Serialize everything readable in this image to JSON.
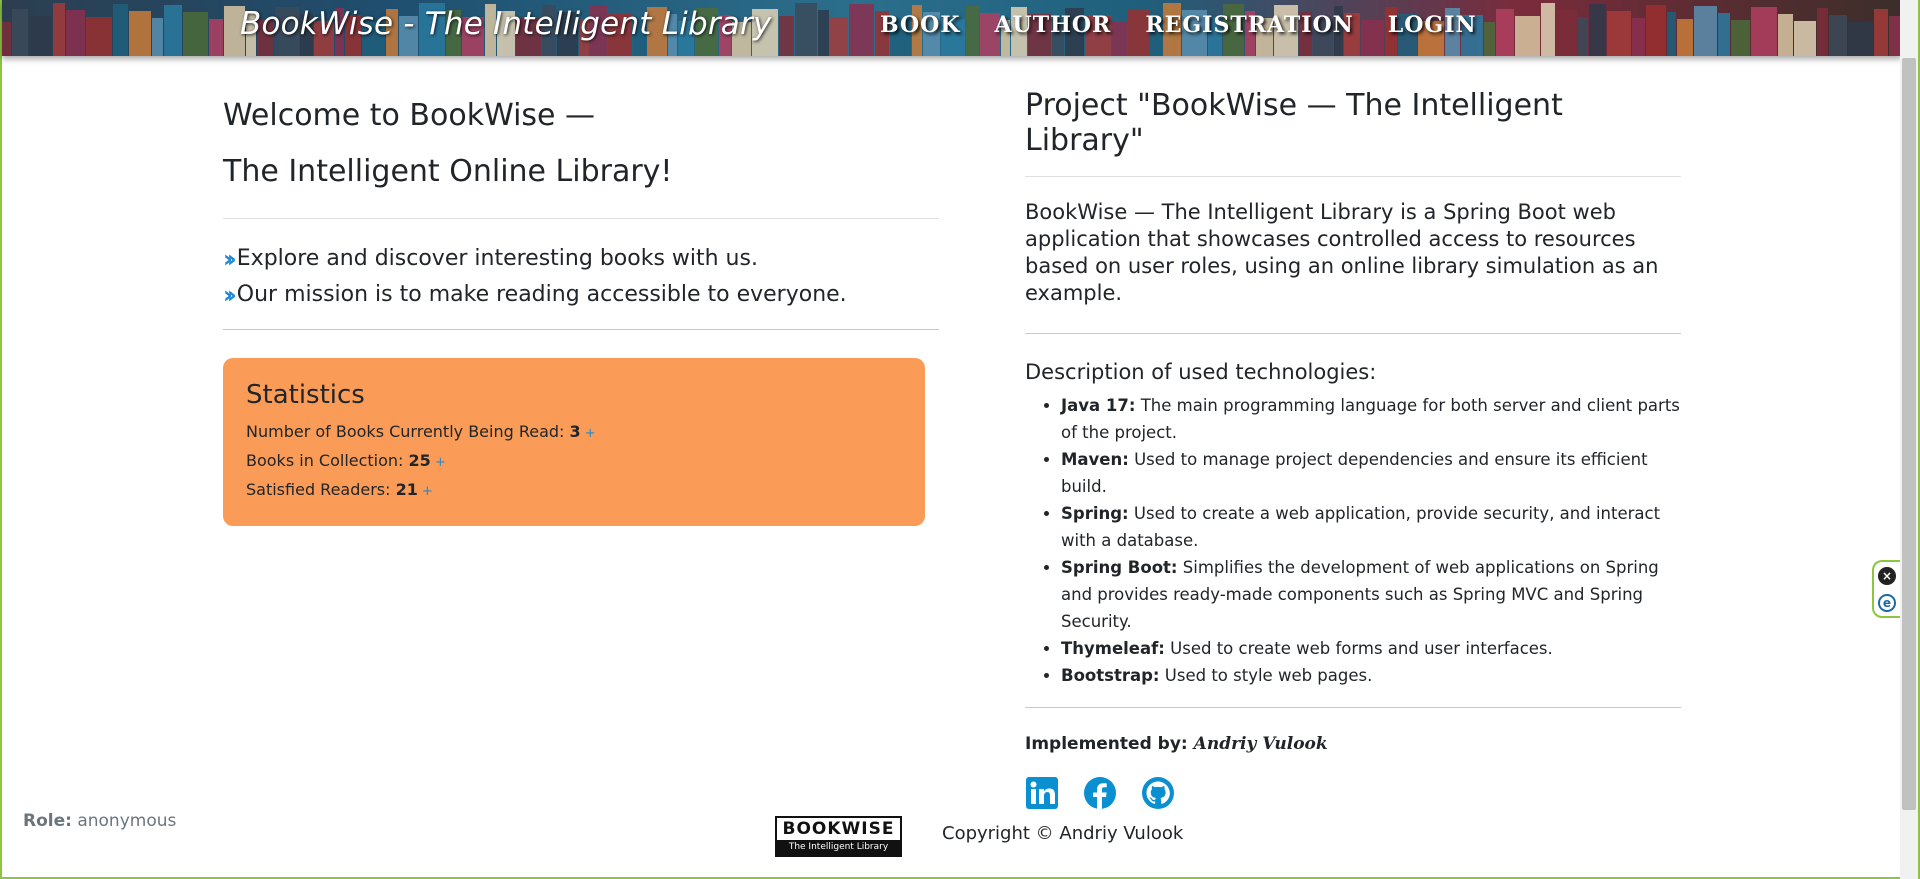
{
  "header": {
    "brand": "BookWise - The Intelligent Library",
    "nav": [
      "Book",
      "Author",
      "Registration",
      "Login"
    ]
  },
  "left": {
    "title_line1": "Welcome to BookWise —",
    "title_line2": "The Intelligent Online Library!",
    "bullets": [
      "Explore and discover interesting books with us.",
      "Our mission is to make reading accessible to everyone."
    ],
    "stats": {
      "title": "Statistics",
      "items": [
        {
          "label": "Number of Books Currently Being Read:",
          "value": "3",
          "plus": "+"
        },
        {
          "label": "Books in Collection:",
          "value": "25",
          "plus": "+"
        },
        {
          "label": "Satisfied Readers:",
          "value": "21",
          "plus": "+"
        }
      ]
    }
  },
  "right": {
    "title": "Project \"BookWise — The Intelligent Library\"",
    "description": "BookWise — The Intelligent Library is a Spring Boot web application that showcases controlled access to resources based on user roles, using an online library simulation as an example.",
    "tech_title": "Description of used technologies:",
    "tech": [
      {
        "name": "Java 17:",
        "text": "The main programming language for both server and client parts of the project."
      },
      {
        "name": "Maven:",
        "text": "Used to manage project dependencies and ensure its efficient build."
      },
      {
        "name": "Spring:",
        "text": "Used to create a web application, provide security, and interact with a database."
      },
      {
        "name": "Spring Boot:",
        "text": "Simplifies the development of web applications on Spring and provides ready-made components such as Spring MVC and Spring Security."
      },
      {
        "name": "Thymeleaf:",
        "text": "Used to create web forms and user interfaces."
      },
      {
        "name": "Bootstrap:",
        "text": "Used to style web pages."
      }
    ],
    "implemented_label": "Implemented by:",
    "implemented_name": "Andriy Vulook",
    "socials": [
      "linkedin-icon",
      "facebook-icon",
      "github-icon"
    ],
    "social_color": "#0a8fd1"
  },
  "footer": {
    "role_label": "Role:",
    "role_value": "anonymous",
    "logo_top": "BOOKWISE",
    "logo_bottom": "The Intelligent Library",
    "copyright": "Copyright © Andriy Vulook"
  },
  "colors": {
    "stats_bg": "#fa9c57",
    "accent": "#1e88d8",
    "frame": "#8cc63f"
  }
}
